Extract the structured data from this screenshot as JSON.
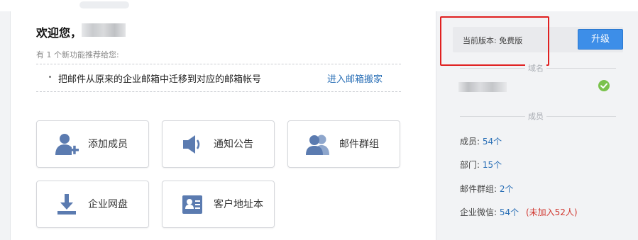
{
  "main": {
    "welcome": "欢迎您，",
    "new_feature_hint": "有 1 个新功能推荐给您:",
    "feature": {
      "text": "把邮件从原来的企业邮箱中迁移到对应的邮箱帐号",
      "link": "进入邮箱搬家"
    },
    "actions": [
      {
        "label": "添加成员",
        "icon": "add-member-icon"
      },
      {
        "label": "通知公告",
        "icon": "speaker-icon"
      },
      {
        "label": "邮件群组",
        "icon": "group-icon"
      },
      {
        "label": "企业网盘",
        "icon": "download-icon"
      },
      {
        "label": "客户地址本",
        "icon": "contact-card-icon"
      }
    ]
  },
  "side": {
    "version_label": "当前版本: 免费版",
    "upgrade": "升级",
    "domain_section": "域名",
    "members_section": "成员",
    "stats": {
      "members": {
        "label": "成员:",
        "value": "54个"
      },
      "departments": {
        "label": "部门:",
        "value": "15个"
      },
      "mail_groups": {
        "label": "邮件群组:",
        "value": "2个"
      },
      "wechat": {
        "label": "企业微信:",
        "value": "54个",
        "note": "(未加入52人)"
      }
    }
  },
  "colors": {
    "accent": "#3d8ee8",
    "link": "#2a6fb6",
    "icon": "#5b7bb0",
    "warn": "#d0342c",
    "ok": "#7ac24c",
    "highlight": "#e02020"
  }
}
